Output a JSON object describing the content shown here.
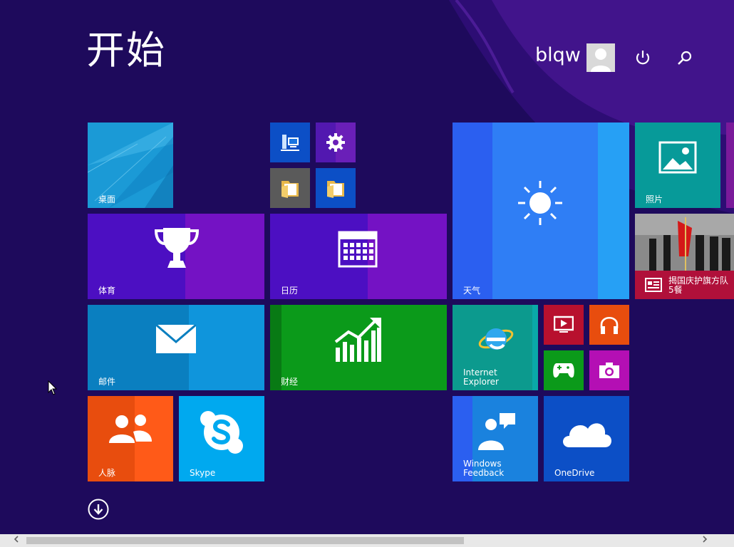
{
  "header": {
    "title": "开始",
    "user_name": "blqw"
  },
  "tiles": {
    "desktop": {
      "label": "桌面"
    },
    "sports": {
      "label": "体育"
    },
    "calendar": {
      "label": "日历"
    },
    "weather": {
      "label": "天气"
    },
    "photos": {
      "label": "照片"
    },
    "news": {
      "label": "揭国庆护旗方队\n5餐"
    },
    "mail": {
      "label": "邮件"
    },
    "finance": {
      "label": "财经"
    },
    "ie": {
      "label": "Internet\nExplorer"
    },
    "people": {
      "label": "人脉"
    },
    "skype": {
      "label": "Skype"
    },
    "feedback": {
      "label": "Windows\nFeedback"
    },
    "onedrive": {
      "label": "OneDrive"
    }
  },
  "colors": {
    "background": "#1e0a5c",
    "desktop": "#1b9ad6",
    "sports": "#4c0fc2",
    "calendar": "#4c0fc2",
    "weather": "#2b5ff0",
    "photos": "#079a99",
    "mail": "#0a7fc0",
    "finance": "#0b9a1a",
    "ie": "#0c9a8e",
    "people": "#e84d0e",
    "skype": "#00a9ef",
    "feedback": "#1a82de",
    "onedrive": "#0c4fc6"
  },
  "icons": {
    "power": "power-icon",
    "search": "search-icon",
    "all_apps": "down-arrow-icon"
  }
}
